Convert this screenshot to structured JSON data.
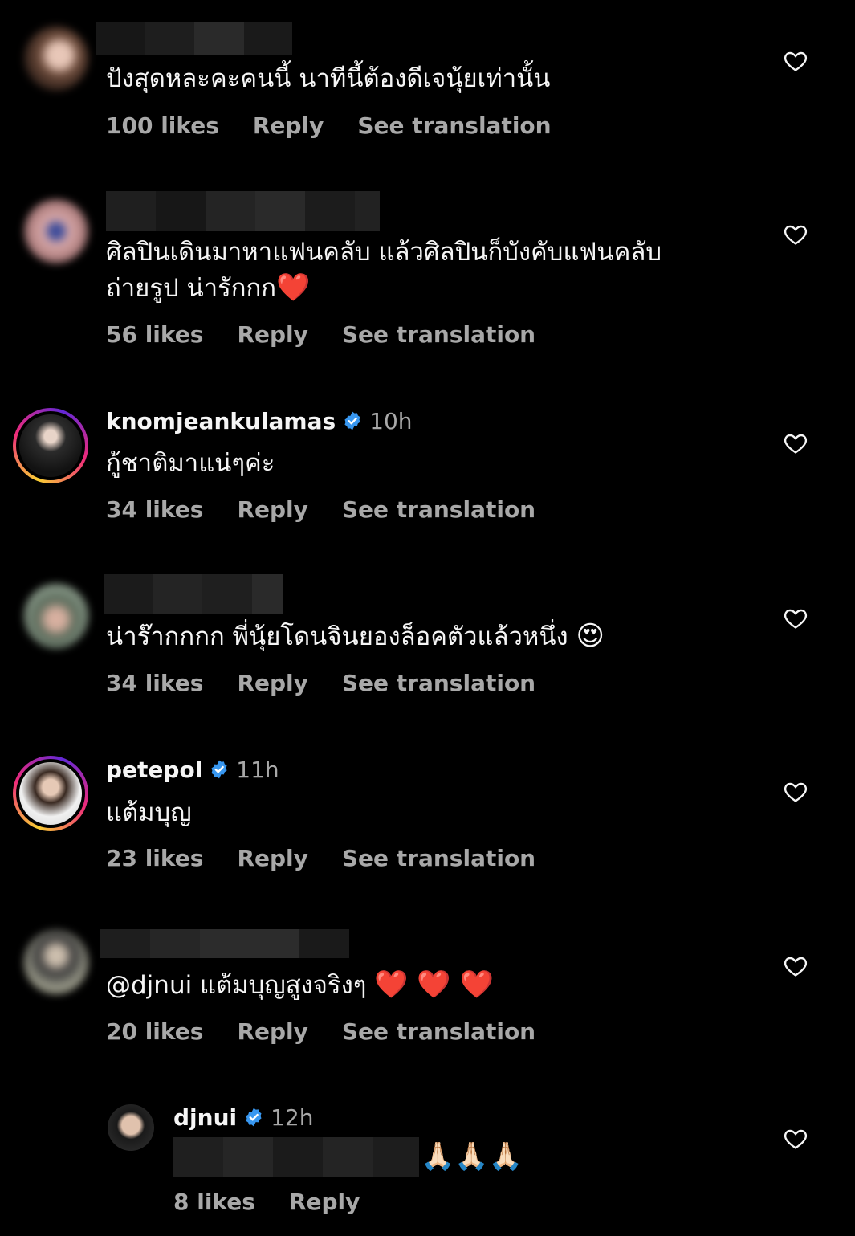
{
  "comments": [
    {
      "username": "",
      "time": "",
      "text": "ปังสุดหละคะคนนี้ นาทีนี้ต้องดีเจนุ้ยเท่านั้น",
      "likes": "100 likes",
      "reply": "Reply",
      "translate": "See translation"
    },
    {
      "username": "",
      "time": "",
      "text_line1": "ศิลปินเดินมาหาแฟนคลับ แล้วศิลปินก็บังคับแฟนคลับ",
      "text_line2": "ถ่ายรูป น่ารักกก",
      "text_emoji": "❤️",
      "likes": "56 likes",
      "reply": "Reply",
      "translate": "See translation"
    },
    {
      "username": "knomjeankulamas",
      "time": "10h",
      "text": "กู้ชาติมาแน่ๆค่ะ",
      "likes": "34 likes",
      "reply": "Reply",
      "translate": "See translation"
    },
    {
      "username": "",
      "time": "",
      "text": "น่าร๊ากกกก พี่นุ้ยโดนจินยองล็อคตัวแล้วหนึ่ง",
      "text_emoji": "😍",
      "likes": "34 likes",
      "reply": "Reply",
      "translate": "See translation"
    },
    {
      "username": "petepol",
      "time": "11h",
      "text": "แต้มบุญ",
      "likes": "23 likes",
      "reply": "Reply",
      "translate": "See translation"
    },
    {
      "username": "",
      "time": "",
      "text": "@djnui แต้มบุญสูงจริงๆ",
      "text_emoji": "❤️ ❤️ ❤️",
      "likes": "20 likes",
      "reply": "Reply",
      "translate": "See translation"
    },
    {
      "username": "djnui",
      "time": "12h",
      "text_emoji": "🙏🏻🙏🏻🙏🏻",
      "likes": "8 likes",
      "reply": "Reply"
    }
  ],
  "colors": {
    "background": "#000000",
    "primary_text": "#f5f5f5",
    "secondary_text": "#a8a8a8",
    "verified": "#3897f0"
  },
  "icons": {
    "like": "heart-outline-icon",
    "verified": "verified-badge-icon"
  }
}
